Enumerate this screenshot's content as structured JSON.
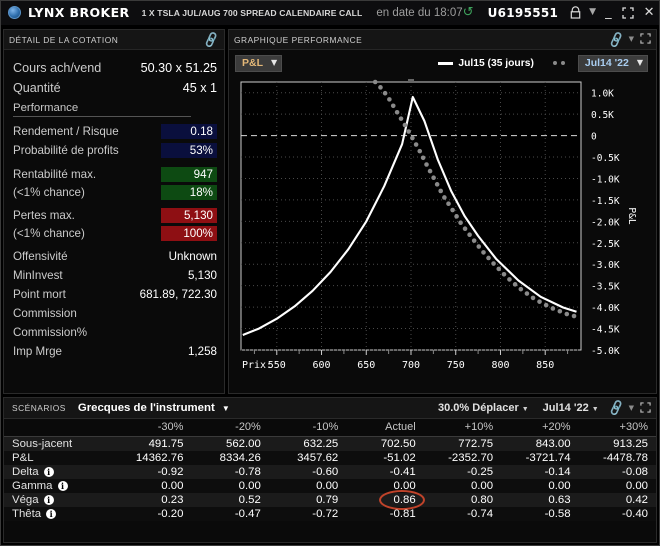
{
  "titlebar": {
    "logo": "globe-icon",
    "brand": "LYNX BROKER",
    "contract": "1 X TSLA JUL/AUG 700 SPREAD CALENDAIRE CALL",
    "asof": "en date du 18:07",
    "refresh_icon": "refresh-icon",
    "account": "U6195551",
    "lock_icon": "lock-icon",
    "caret_icon": "chevron-down-icon",
    "minimize_icon": "minimize-icon",
    "maximize_icon": "maximize-icon",
    "close_icon": "close-icon"
  },
  "quote_panel": {
    "header": "DÉTAIL DE LA COTATION",
    "link_icon": "link-icon",
    "rows": [
      {
        "label": "Cours ach/vend",
        "value": "50.30 x 51.25",
        "style": "plain"
      },
      {
        "label": "Quantité",
        "value": "45 x 1",
        "style": "plain"
      }
    ],
    "section_title": "Performance",
    "perf_rows": [
      {
        "label": "Rendement / Risque",
        "value": "0.18",
        "style": "navy"
      },
      {
        "label": "Probabilité de profits",
        "value": "53%",
        "style": "navy"
      },
      {
        "label": "Rentabilité max.",
        "value": "947",
        "style": "green"
      },
      {
        "label": "(<1% chance)",
        "value": "18%",
        "style": "green"
      },
      {
        "label": "Pertes max.",
        "value": "5,130",
        "style": "red"
      },
      {
        "label": "(<1% chance)",
        "value": "100%",
        "style": "red"
      },
      {
        "label": "Offensivité",
        "value": "Unknown",
        "style": "plain"
      },
      {
        "label": "MinInvest",
        "value": "5,130",
        "style": "plain"
      },
      {
        "label": "Point mort",
        "value": "681.89, 722.30",
        "style": "plain"
      },
      {
        "label": "Commission",
        "value": "",
        "style": "plain"
      },
      {
        "label": "Commission%",
        "value": "",
        "style": "plain"
      },
      {
        "label": "Imp Mrge",
        "value": "1,258",
        "style": "plain"
      }
    ]
  },
  "chart_panel": {
    "header": "GRAPHIQUE PERFORMANCE",
    "link_icon": "link-icon",
    "caret_icon": "chevron-down-icon",
    "expand_icon": "expand-icon",
    "metric_dropdown": "P&L",
    "legend_line_label": "Jul15 (35 jours)",
    "date_dropdown": "Jul14 '22"
  },
  "chart_data": {
    "type": "line",
    "title": "GRAPHIQUE PERFORMANCE",
    "xlabel": "Prix:",
    "ylabel": "P&L",
    "xticks": [
      550,
      600,
      650,
      700,
      750,
      800,
      850
    ],
    "yticks": [
      "1.0K",
      "0.5K",
      "0",
      "-0.5K",
      "-1.0K",
      "-1.5K",
      "-2.0K",
      "-2.5K",
      "-3.0K",
      "-3.5K",
      "-4.0K",
      "-4.5K",
      "-5.0K"
    ],
    "xlim": [
      510,
      890
    ],
    "ylim": [
      -5000,
      1250
    ],
    "grid": true,
    "zero_line": 0,
    "legend_position": "top",
    "series": [
      {
        "name": "Jul15 (35 jours)",
        "style": "solid",
        "color": "#ffffff",
        "points": [
          [
            512,
            -4650
          ],
          [
            530,
            -4500
          ],
          [
            550,
            -4270
          ],
          [
            570,
            -3980
          ],
          [
            590,
            -3620
          ],
          [
            610,
            -3180
          ],
          [
            630,
            -2650
          ],
          [
            650,
            -2000
          ],
          [
            670,
            -1180
          ],
          [
            690,
            -200
          ],
          [
            702,
            900
          ],
          [
            715,
            340
          ],
          [
            730,
            -560
          ],
          [
            745,
            -1300
          ],
          [
            760,
            -1880
          ],
          [
            775,
            -2340
          ],
          [
            795,
            -2870
          ],
          [
            820,
            -3380
          ],
          [
            845,
            -3760
          ],
          [
            870,
            -4010
          ],
          [
            885,
            -4110
          ]
        ]
      },
      {
        "name": "expiration-dotted",
        "style": "dotted",
        "color": "#8a8a8a",
        "points": [
          [
            660,
            1250
          ],
          [
            668,
            1080
          ],
          [
            676,
            840
          ],
          [
            684,
            560
          ],
          [
            692,
            290
          ],
          [
            700,
            0
          ],
          [
            709,
            -330
          ],
          [
            718,
            -700
          ],
          [
            727,
            -1050
          ],
          [
            736,
            -1400
          ],
          [
            746,
            -1720
          ],
          [
            756,
            -2050
          ],
          [
            768,
            -2380
          ],
          [
            780,
            -2700
          ],
          [
            793,
            -3000
          ],
          [
            807,
            -3300
          ],
          [
            822,
            -3570
          ],
          [
            838,
            -3810
          ],
          [
            856,
            -4010
          ],
          [
            874,
            -4160
          ],
          [
            886,
            -4230
          ]
        ]
      }
    ]
  },
  "scenarios": {
    "tag": "SCÉNARIOS",
    "selector": "Grecques de l'instrument",
    "selector_caret": "chevron-down-icon",
    "shift_dropdown": "30.0% Déplacer",
    "date_dropdown": "Jul14 '22",
    "link_icon": "link-icon",
    "caret_icon": "chevron-down-icon",
    "expand_icon": "expand-icon",
    "columns": [
      "",
      "-30%",
      "-20%",
      "-10%",
      "Actuel",
      "+10%",
      "+20%",
      "+30%"
    ],
    "rows": [
      {
        "label": "Sous-jacent",
        "info": false,
        "values": [
          "491.75",
          "562.00",
          "632.25",
          "702.50",
          "772.75",
          "843.00",
          "913.25"
        ]
      },
      {
        "label": "P&L",
        "info": false,
        "values": [
          "14362.76",
          "8334.26",
          "3457.62",
          "-51.02",
          "-2352.70",
          "-3721.74",
          "-4478.78"
        ]
      },
      {
        "label": "Delta",
        "info": true,
        "values": [
          "-0.92",
          "-0.78",
          "-0.60",
          "-0.41",
          "-0.25",
          "-0.14",
          "-0.08"
        ]
      },
      {
        "label": "Gamma",
        "info": true,
        "values": [
          "0.00",
          "0.00",
          "0.00",
          "0.00",
          "0.00",
          "0.00",
          "0.00"
        ]
      },
      {
        "label": "Véga",
        "info": true,
        "values": [
          "0.23",
          "0.52",
          "0.79",
          "0.86",
          "0.80",
          "0.63",
          "0.42"
        ]
      },
      {
        "label": "Thêta",
        "info": true,
        "values": [
          "-0.20",
          "-0.47",
          "-0.72",
          "-0.81",
          "-0.74",
          "-0.58",
          "-0.40"
        ]
      }
    ],
    "annotation": {
      "row": 4,
      "col": 3,
      "shape": "ellipse",
      "color": "#c0432a"
    }
  },
  "colors": {
    "accent_green": "#3fbf5f",
    "navy": "#0a0f3d",
    "green": "#0d4a12",
    "red": "#8e0f13",
    "annot": "#c0432a"
  }
}
